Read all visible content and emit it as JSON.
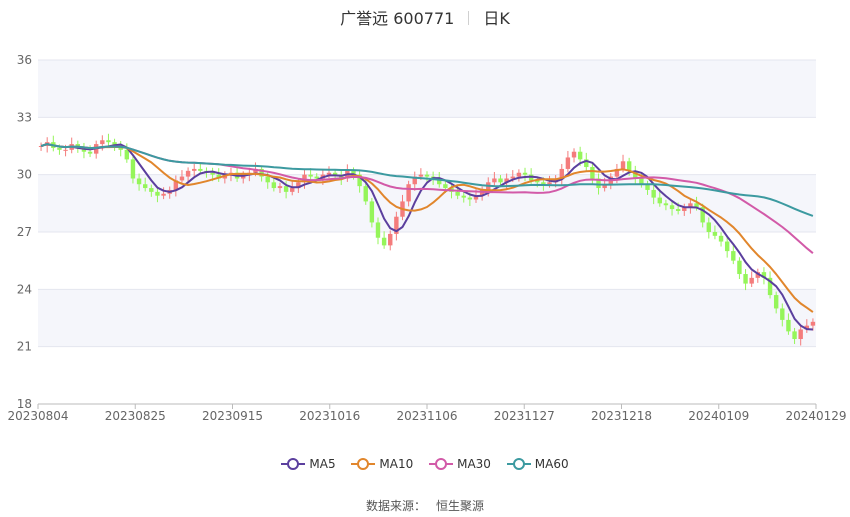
{
  "chart_data": {
    "type": "candlestick",
    "title": "广誉远 600771",
    "subtitle": "日K",
    "ylim": [
      18,
      36
    ],
    "yticks": [
      18,
      21,
      24,
      27,
      30,
      33,
      36
    ],
    "xticks": [
      "20230804",
      "20230825",
      "20230915",
      "20231016",
      "20231106",
      "20231127",
      "20231218",
      "20240109",
      "20240129"
    ],
    "grid": true,
    "legend_position": "bottom",
    "up_color": "#f47c7c",
    "down_color": "#95f55a",
    "close": [
      31.5,
      31.7,
      31.4,
      31.3,
      31.3,
      31.6,
      31.4,
      31.2,
      31.1,
      31.6,
      31.8,
      31.7,
      31.5,
      31.3,
      30.8,
      29.8,
      29.5,
      29.3,
      29.1,
      28.9,
      29.0,
      29.2,
      29.7,
      29.9,
      30.2,
      30.3,
      30.2,
      30.1,
      30.0,
      29.8,
      30.0,
      30.1,
      29.8,
      30.0,
      30.1,
      30.3,
      29.9,
      29.6,
      29.3,
      29.4,
      29.1,
      29.3,
      29.6,
      30.0,
      29.9,
      29.8,
      30.0,
      30.1,
      30.0,
      29.8,
      30.2,
      30.0,
      29.4,
      28.6,
      27.5,
      26.7,
      26.3,
      26.9,
      27.8,
      28.6,
      29.5,
      29.9,
      30.0,
      29.9,
      29.8,
      29.5,
      29.3,
      29.1,
      28.9,
      28.8,
      28.7,
      28.9,
      29.2,
      29.6,
      29.8,
      29.6,
      29.8,
      29.9,
      30.1,
      30.0,
      29.7,
      29.6,
      29.5,
      29.6,
      29.8,
      30.3,
      30.9,
      31.2,
      30.8,
      30.4,
      29.8,
      29.3,
      29.5,
      29.9,
      30.3,
      30.7,
      30.2,
      29.8,
      29.5,
      29.2,
      28.8,
      28.5,
      28.4,
      28.2,
      28.1,
      28.3,
      28.5,
      28.3,
      27.5,
      27.0,
      26.8,
      26.5,
      26.0,
      25.5,
      24.8,
      24.3,
      24.6,
      24.9,
      24.6,
      23.7,
      23.0,
      22.4,
      21.8,
      21.4,
      21.9,
      22.1,
      22.3
    ]
  },
  "legend": [
    {
      "label": "MA5",
      "color": "#5b3f9e"
    },
    {
      "label": "MA10",
      "color": "#e1862c"
    },
    {
      "label": "MA30",
      "color": "#d25aa8"
    },
    {
      "label": "MA60",
      "color": "#3c9aa0"
    }
  ],
  "source": {
    "label": "数据来源：",
    "name": "恒生聚源"
  }
}
